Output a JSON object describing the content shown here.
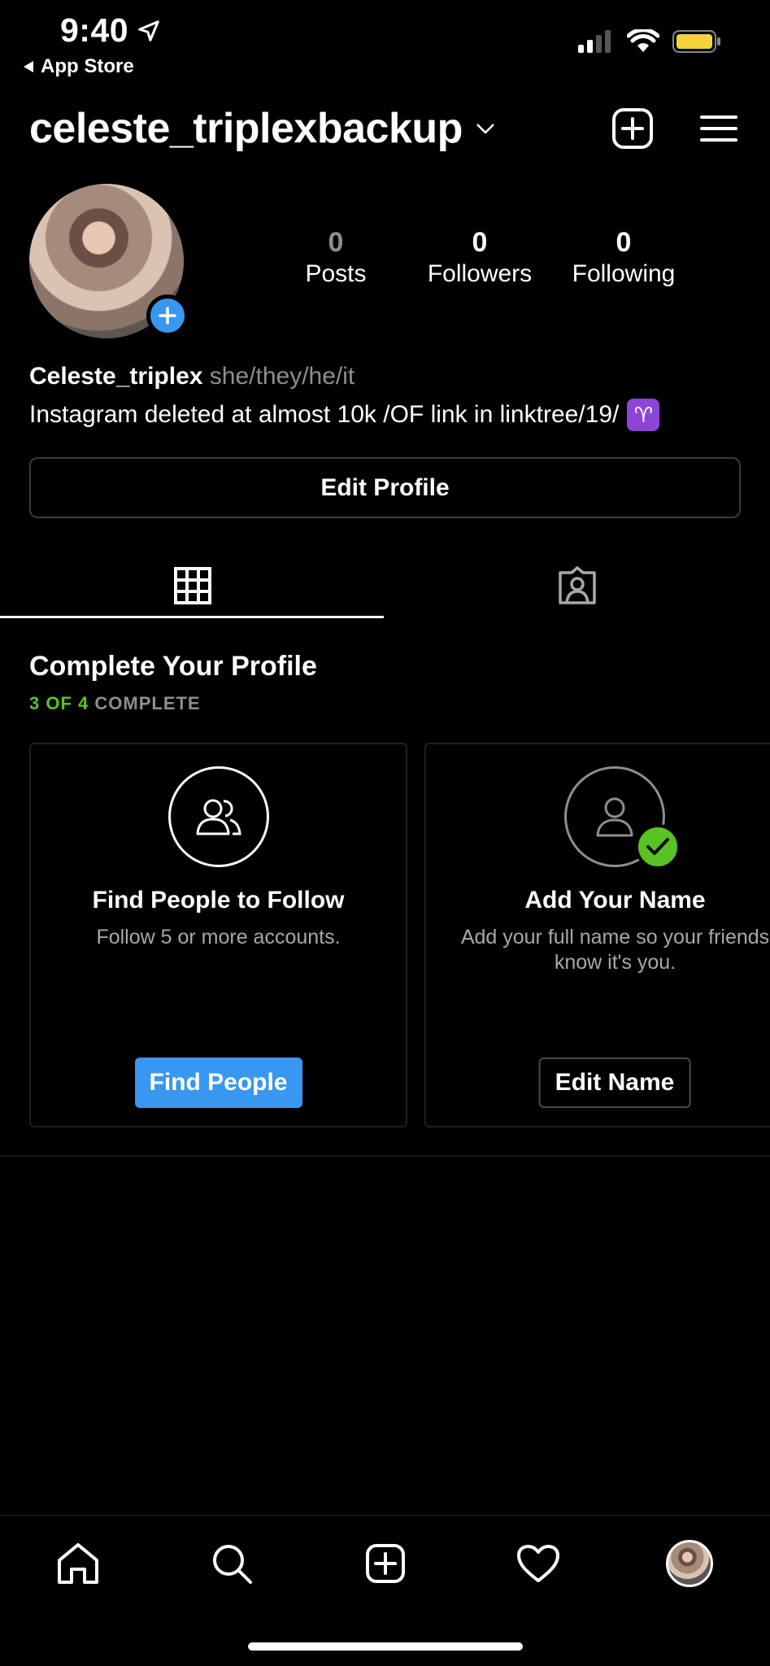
{
  "status_bar": {
    "time": "9:40",
    "back_label": "App Store"
  },
  "header": {
    "username": "celeste_triplexbackup"
  },
  "profile": {
    "stats": [
      {
        "value": "0",
        "label": "Posts"
      },
      {
        "value": "0",
        "label": "Followers"
      },
      {
        "value": "0",
        "label": "Following"
      }
    ],
    "display_name": "Celeste_triplex",
    "pronouns": "she/they/he/it",
    "bio": "Instagram deleted at almost 10k /OF link in linktree/19/",
    "bio_emoji": "♈",
    "edit_profile_label": "Edit Profile"
  },
  "complete_profile": {
    "title": "Complete Your Profile",
    "progress_done": "3 OF 4",
    "progress_rest": "COMPLETE",
    "cards": [
      {
        "title": "Find People to Follow",
        "description": "Follow 5 or more accounts.",
        "button": "Find People"
      },
      {
        "title": "Add Your Name",
        "description": "Add your full name so your friends know it's you.",
        "button": "Edit Name"
      }
    ]
  },
  "colors": {
    "accent_blue": "#3897f0",
    "complete_green": "#58c322",
    "battery_yellow": "#f5d33b"
  }
}
